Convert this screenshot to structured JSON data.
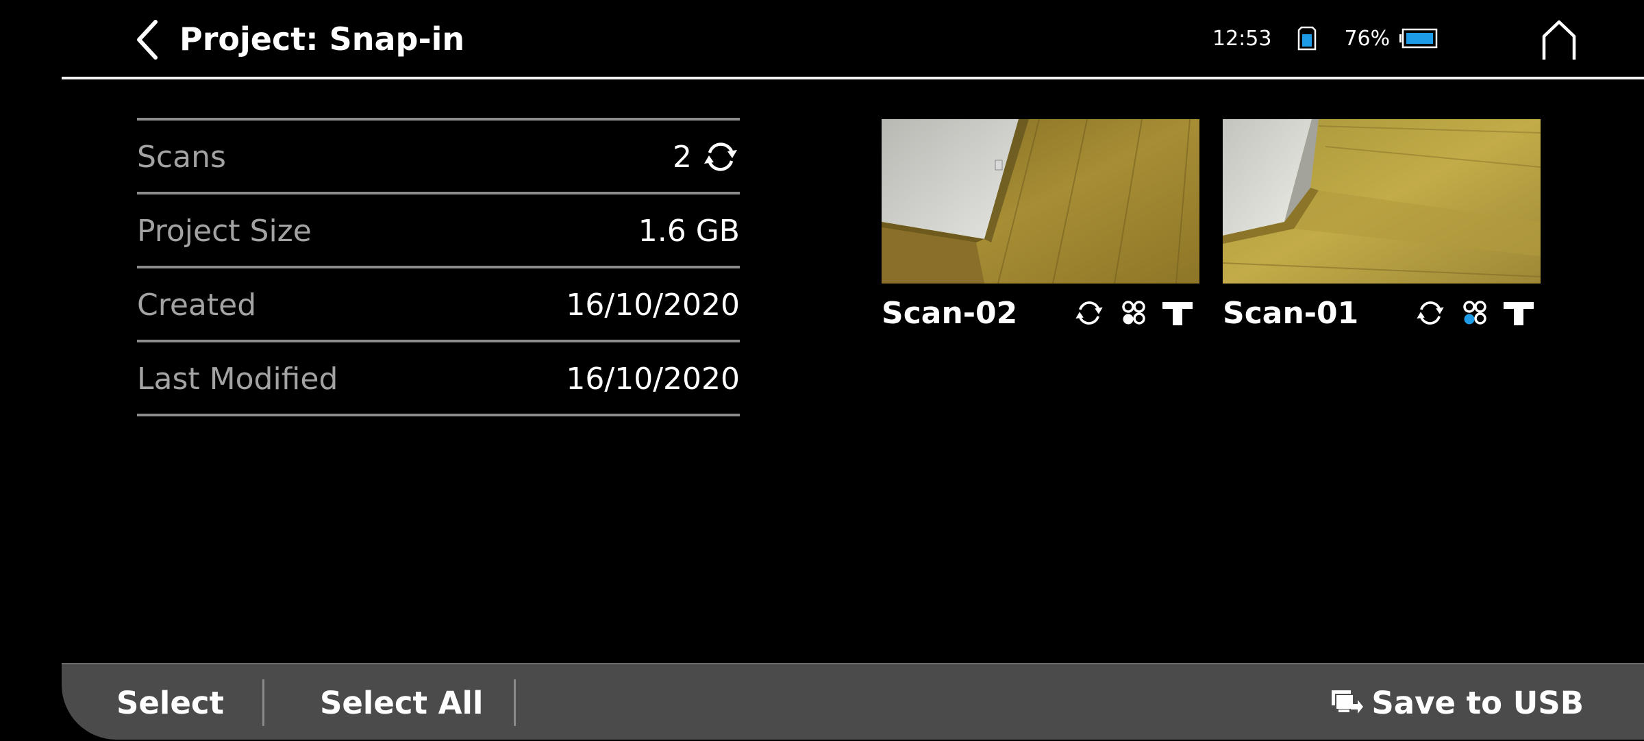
{
  "header": {
    "title": "Project: Snap-in",
    "back_icon": "chevron-left-icon",
    "home_icon": "home-icon"
  },
  "status": {
    "time": "12:53",
    "sd_icon": "sd-card-icon",
    "battery_percent": "76%",
    "battery_level": 0.76,
    "accent_color": "#1e9be6"
  },
  "info": {
    "rows": [
      {
        "label": "Scans",
        "value": "2"
      },
      {
        "label": "Project Size",
        "value": "1.6 GB"
      },
      {
        "label": "Created",
        "value": "16/10/2020"
      },
      {
        "label": "Last Modified",
        "value": "16/10/2020"
      }
    ]
  },
  "scans": [
    {
      "name": "Scan-02",
      "icons": [
        "sync-icon",
        "cluster-icon",
        "tripod-icon"
      ],
      "cluster_dot_active": false
    },
    {
      "name": "Scan-01",
      "icons": [
        "sync-icon",
        "cluster-icon",
        "tripod-icon"
      ],
      "cluster_dot_active": true
    }
  ],
  "bottom_bar": {
    "select_label": "Select",
    "select_all_label": "Select All",
    "save_label": "Save to USB",
    "save_icon": "usb-transfer-icon"
  }
}
